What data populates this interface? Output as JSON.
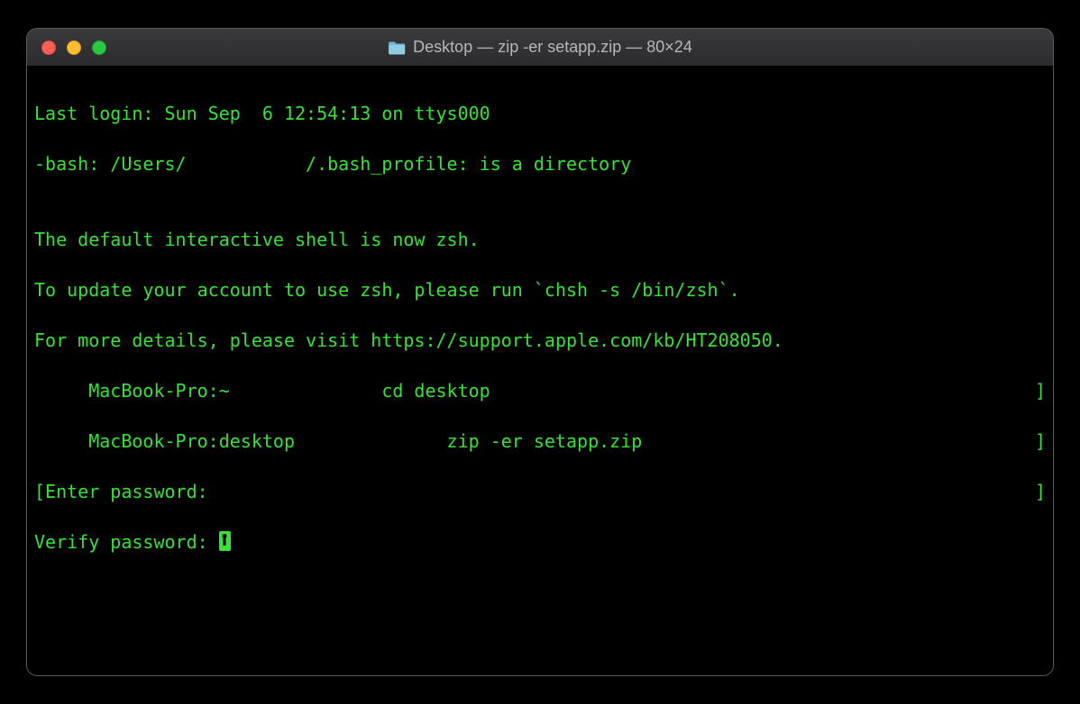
{
  "window": {
    "title": "Desktop — zip -er setapp.zip — 80×24"
  },
  "terminal": {
    "line1": "Last login: Sun Sep  6 12:54:13 on ttys000",
    "line2": "-bash: /Users/           /.bash_profile: is a directory",
    "blank1": "",
    "line3": "The default interactive shell is now zsh.",
    "line4": "To update your account to use zsh, please run `chsh -s /bin/zsh`.",
    "line5": "For more details, please visit https://support.apple.com/kb/HT208050.",
    "prompt1_left": "     MacBook-Pro:~              cd desktop",
    "prompt1_right": "]",
    "prompt2_left": "     MacBook-Pro:desktop              zip -er setapp.zip",
    "prompt2_right": "]",
    "enter_left": "[Enter password: ",
    "enter_right": "]",
    "verify": "Verify password: "
  }
}
